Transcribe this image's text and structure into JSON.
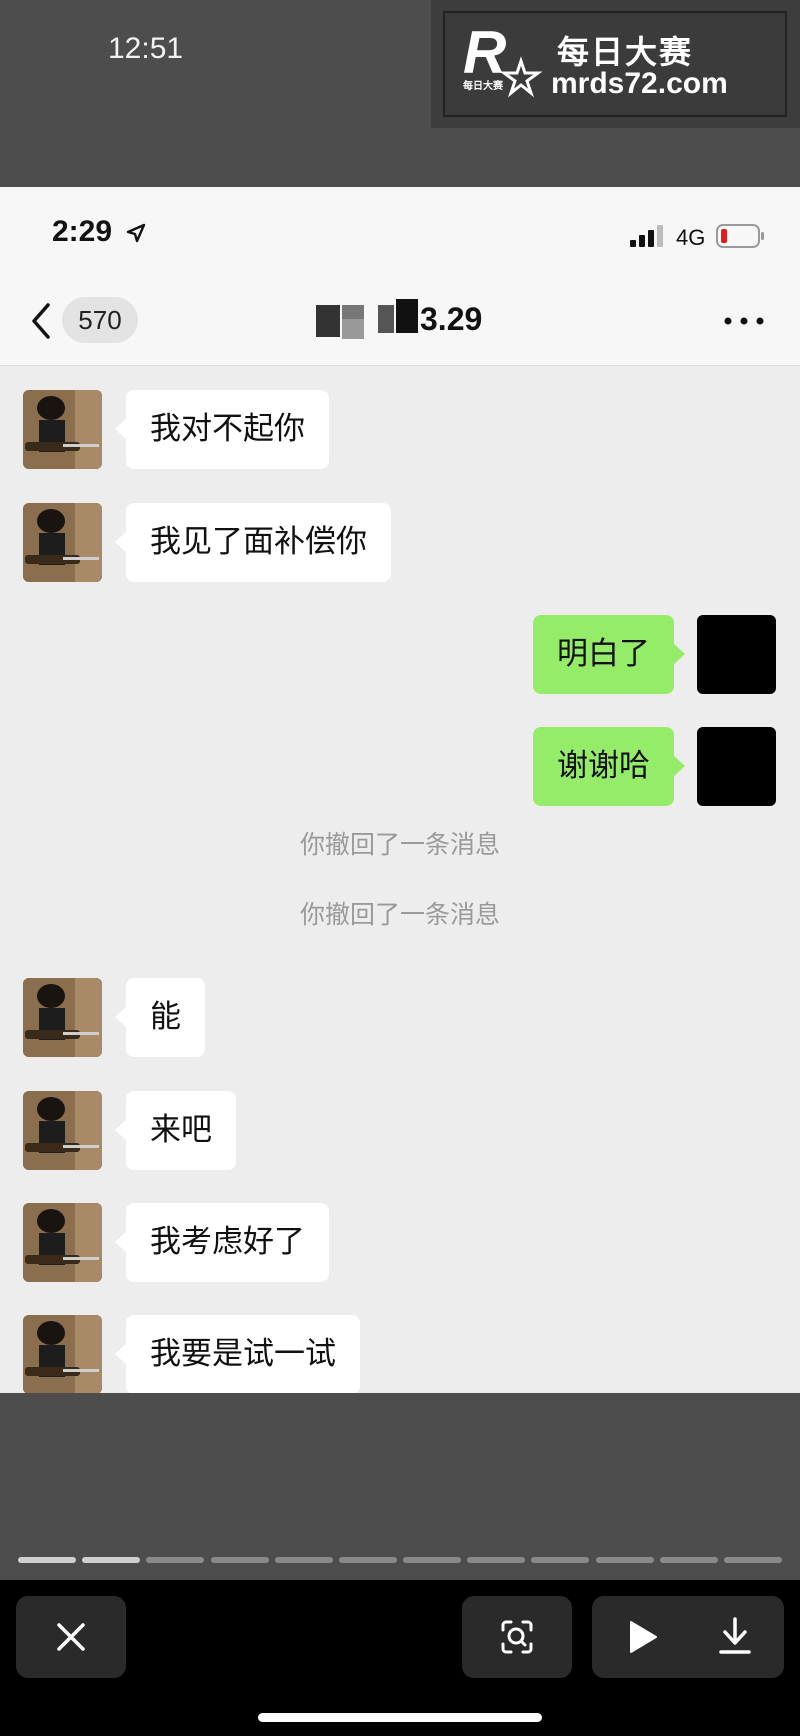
{
  "outer_status": {
    "time": "12:51"
  },
  "watermark": {
    "line1": "每日大赛",
    "line2": "mrds72.com",
    "logo_letter": "R",
    "logo_sub": "每日大赛"
  },
  "phone_status": {
    "time": "2:29",
    "network": "4G"
  },
  "chat_header": {
    "unread_badge": "570",
    "title_visible": "3.29"
  },
  "messages": [
    {
      "side": "left",
      "text": "我对不起你"
    },
    {
      "side": "left",
      "text": "我见了面补偿你"
    },
    {
      "side": "right",
      "text": "明白了"
    },
    {
      "side": "right",
      "text": "谢谢哈"
    },
    {
      "side": "system",
      "text": "你撤回了一条消息"
    },
    {
      "side": "system",
      "text": "你撤回了一条消息"
    },
    {
      "side": "left",
      "text": "能"
    },
    {
      "side": "left",
      "text": "来吧"
    },
    {
      "side": "left",
      "text": "我考虑好了"
    },
    {
      "side": "left",
      "text": "我要是试一试"
    }
  ],
  "viewer": {
    "progress_total": 12,
    "progress_done": 2
  },
  "icons": {
    "close": "close-icon",
    "lens": "image-search-icon",
    "play": "play-icon",
    "download": "download-icon",
    "back": "chevron-left-icon",
    "more": "more-dots-icon",
    "location": "location-arrow-icon",
    "signal": "signal-icon",
    "battery": "battery-low-icon"
  },
  "colors": {
    "sent_bubble": "#95ec69",
    "received_bubble": "#ffffff",
    "chat_bg": "#ededed",
    "battery_low": "#e02020"
  }
}
